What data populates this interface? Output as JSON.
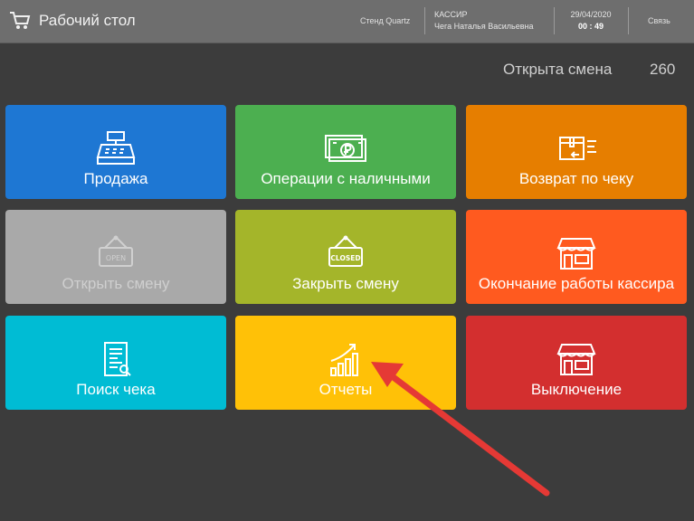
{
  "header": {
    "title": "Рабочий стол",
    "stand": "Стенд Quartz",
    "role": "КАССИР",
    "user": "Чега Наталья Васильевна",
    "date": "29/04/2020",
    "time": "00 : 49",
    "link": "Связь"
  },
  "shift": {
    "label": "Открыта смена",
    "number": "260"
  },
  "tiles": [
    {
      "label": "Продажа",
      "color": "#1e77d3",
      "icon": "cash-register-icon",
      "enabled": true
    },
    {
      "label": "Операции с наличными",
      "color": "#4caf50",
      "icon": "cash-icon",
      "enabled": true
    },
    {
      "label": "Возврат по чеку",
      "color": "#e67e00",
      "icon": "return-box-icon",
      "enabled": true
    },
    {
      "label": "Открыть смену",
      "color": "#a9a9a9",
      "icon": "open-sign-icon",
      "enabled": false,
      "sign_text": "OPEN"
    },
    {
      "label": "Закрыть смену",
      "color": "#a4b52a",
      "icon": "closed-sign-icon",
      "enabled": true,
      "sign_text": "CLOSED"
    },
    {
      "label": "Окончание работы кассира",
      "color": "#ff5a1f",
      "icon": "shop-icon",
      "enabled": true
    },
    {
      "label": "Поиск чека",
      "color": "#00bcd4",
      "icon": "receipt-icon",
      "enabled": true
    },
    {
      "label": "Отчеты",
      "color": "#ffc107",
      "icon": "chart-growth-icon",
      "enabled": true
    },
    {
      "label": "Выключение",
      "color": "#d32f2f",
      "icon": "shop-icon",
      "enabled": true
    }
  ],
  "annotation": {
    "arrow_color": "#e53935"
  }
}
